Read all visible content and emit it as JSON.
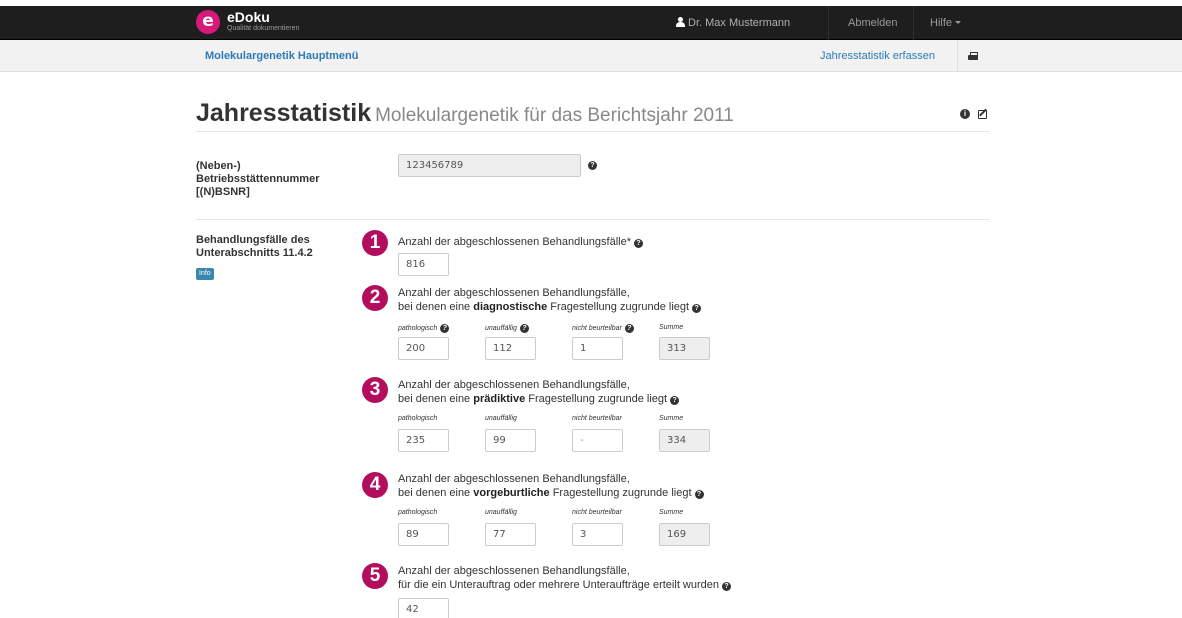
{
  "app": {
    "name": "eDoku",
    "tagline": "Qualität dokumentieren",
    "logo_letter": "e"
  },
  "topnav": {
    "user": "Dr. Max Mustermann",
    "logout": "Abmelden",
    "help": "Hilfe"
  },
  "subnav": {
    "main_menu": "Molekulargenetik Hauptmenü",
    "capture_link": "Jahresstatistik erfassen"
  },
  "header": {
    "title": "Jahresstatistik",
    "subtitle": "Molekulargenetik für das Berichtsjahr 2011"
  },
  "bsnr": {
    "label_line1": "(Neben-)",
    "label_line2": "Betriebsstättennummer",
    "label_line3": "[(N)BSNR]",
    "value": "123456789"
  },
  "cases": {
    "label_line1": "Behandlungsfälle des",
    "label_line2": "Unterabschnitts 11.4.2",
    "info_badge": "Info"
  },
  "questions": {
    "q1": {
      "number": "1",
      "text": "Anzahl der abgeschlossenen Behandlungsfälle*",
      "value": "816"
    },
    "q2": {
      "number": "2",
      "line1": "Anzahl der abgeschlossenen Behandlungsfälle,",
      "pre": "bei denen eine ",
      "bold": "diagnostische",
      "post": " Fragestellung zugrunde liegt",
      "pathologisch": "200",
      "unauffaellig": "112",
      "nicht_beurteilbar": "1",
      "summe": "313"
    },
    "q3": {
      "number": "3",
      "line1": "Anzahl der abgeschlossenen Behandlungsfälle,",
      "pre": "bei denen eine ",
      "bold": "prädiktive",
      "post": " Fragestellung zugrunde liegt",
      "pathologisch": "235",
      "unauffaellig": "99",
      "nicht_beurteilbar": "-",
      "summe": "334"
    },
    "q4": {
      "number": "4",
      "line1": "Anzahl der abgeschlossenen Behandlungsfälle,",
      "pre": "bei denen eine ",
      "bold": "vorgeburtliche",
      "post": " Fragestellung zugrunde liegt",
      "pathologisch": "89",
      "unauffaellig": "77",
      "nicht_beurteilbar": "3",
      "summe": "169"
    },
    "q5": {
      "number": "5",
      "line1": "Anzahl der abgeschlossenen Behandlungsfälle,",
      "line2": "für die ein Unterauftrag oder mehrere Unteraufträge erteilt wurden",
      "value": "42"
    }
  },
  "sublabels": {
    "pathologisch": "pathologisch",
    "unauffaellig": "unauffällig",
    "nicht_beurteilbar": "nicht beurteilbar",
    "summe": "Summe"
  },
  "icons": {
    "help": "?",
    "info": "i"
  },
  "colors": {
    "navbar": "#1e1e1e",
    "brand": "#d6197a",
    "step_number": "#b30d5e",
    "link": "#2e7ab8",
    "info_badge": "#3a87ad"
  }
}
